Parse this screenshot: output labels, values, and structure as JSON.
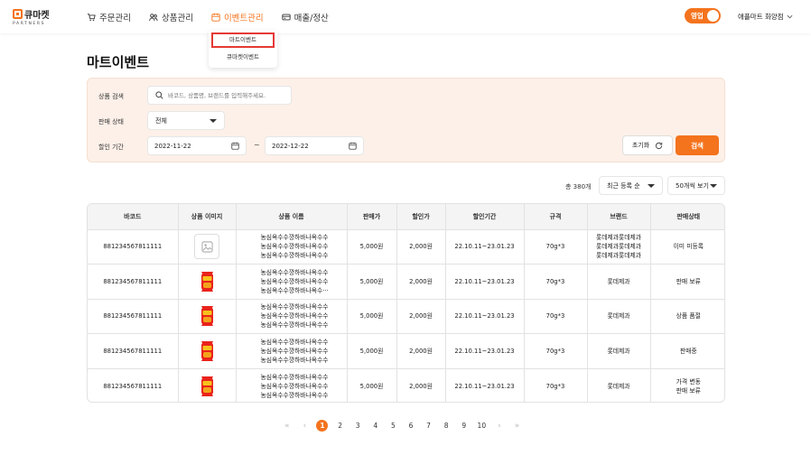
{
  "brand": {
    "name": "큐마켓",
    "sub": "PARTNERS",
    "accent": "#f4731d"
  },
  "nav": [
    {
      "label": "주문관리",
      "icon": "cart-icon",
      "active": false
    },
    {
      "label": "상품관리",
      "icon": "people-icon",
      "active": false
    },
    {
      "label": "이벤트관리",
      "icon": "calendar-icon",
      "active": true
    },
    {
      "label": "매출/정산",
      "icon": "card-icon",
      "active": false
    }
  ],
  "dropdown": {
    "selected": "마트이벤트",
    "other": "큐마켓이벤트"
  },
  "header": {
    "toggle_label": "영업",
    "store_name": "애플마트 화양점"
  },
  "page_title": "마트이벤트",
  "search": {
    "product_label": "상품 검색",
    "product_placeholder": "바코드, 상품명, 브랜드를 입력해주세요.",
    "status_label": "판매 상태",
    "status_value": "전체",
    "period_label": "할인 기간",
    "date_from": "2022-11-22",
    "tilde": "~",
    "date_to": "2022-12-22",
    "reset_label": "초기화",
    "search_label": "검색"
  },
  "list": {
    "total": "총 380개",
    "sort_value": "최근 등록 순",
    "per_page_value": "50개씩 보기"
  },
  "table": {
    "columns": [
      "바코드",
      "상품 이미지",
      "상품 이름",
      "판매가",
      "할인가",
      "할인기간",
      "규격",
      "브랜드",
      "판매상태"
    ],
    "rows": [
      {
        "barcode": "881234567811111",
        "image": "placeholder",
        "name": "농심옥수수깡하바나옥수수\n농심옥수수깡하바나옥수수\n농심옥수수깡하바나옥수수",
        "price": "5,000원",
        "sale": "2,000원",
        "period": "22.10.11~23.01.23",
        "spec": "70g*3",
        "brand": "롯데제과롯데제과\n롯데제과롯데제과\n롯데제과롯데제과",
        "status": "이미 미등록"
      },
      {
        "barcode": "881234567811111",
        "image": "product",
        "name": "농심옥수수깡하바나옥수수\n농심옥수수깡하바나옥수수\n농심옥수수깡하바나옥수···",
        "price": "5,000원",
        "sale": "2,000원",
        "period": "22.10.11~23.01.23",
        "spec": "70g*3",
        "brand": "롯데제과",
        "status": "판매 보류"
      },
      {
        "barcode": "881234567811111",
        "image": "product",
        "name": "농심옥수수깡하바나옥수수\n농심옥수수깡하바나옥수수\n농심옥수수깡하바나옥수수",
        "price": "5,000원",
        "sale": "2,000원",
        "period": "22.10.11~23.01.23",
        "spec": "70g*3",
        "brand": "롯데제과",
        "status": "상품 품절"
      },
      {
        "barcode": "881234567811111",
        "image": "product",
        "name": "농심옥수수깡하바나옥수수\n농심옥수수깡하바나옥수수\n농심옥수수깡하바나옥수수",
        "price": "5,000원",
        "sale": "2,000원",
        "period": "22.10.11~23.01.23",
        "spec": "70g*3",
        "brand": "롯데제과",
        "status": "판매중"
      },
      {
        "barcode": "881234567811111",
        "image": "product",
        "name": "농심옥수수깡하바나옥수수\n농심옥수수깡하바나옥수수\n농심옥수수깡하바나옥수수",
        "price": "5,000원",
        "sale": "2,000원",
        "period": "22.10.11~23.01.23",
        "spec": "70g*3",
        "brand": "롯데제과",
        "status": "가격 변동\n판매 보류"
      }
    ]
  },
  "pagination": {
    "first": "«",
    "prev": "‹",
    "pages": [
      "1",
      "2",
      "3",
      "4",
      "5",
      "6",
      "7",
      "8",
      "9",
      "10"
    ],
    "current": "1",
    "next": "›",
    "last": "»"
  }
}
